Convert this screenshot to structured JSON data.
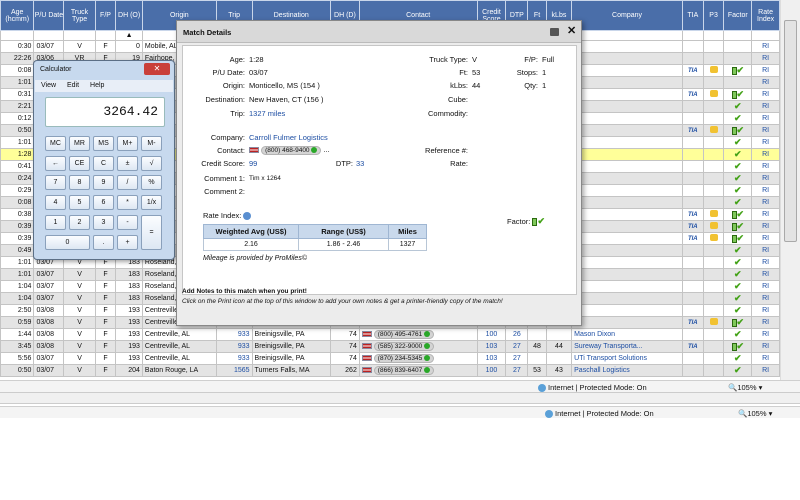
{
  "grid": {
    "headers": [
      "Age (hcmm)",
      "P/U Date",
      "Truck Type",
      "F/P",
      "DH (O)",
      "Origin",
      "Trip",
      "Destination",
      "DH (D)",
      "Contact",
      "Credit Score",
      "DTP",
      "Ft",
      "kLbs",
      "Company",
      "TIA",
      "P3",
      "Factor",
      "Rate Index"
    ],
    "sort_arrow": "▲",
    "rows": [
      {
        "age": "0:30",
        "date": "03/07",
        "truck": "V",
        "fp": "F",
        "dh": "0",
        "origin": "Mobile, AL",
        "trip": "",
        "dest": "",
        "dhd": "",
        "phone": "",
        "credit": "",
        "dtp": "",
        "ft": "",
        "klbs": "",
        "company": "",
        "tia": false,
        "p3": false,
        "factor": false,
        "ri": "RI"
      },
      {
        "age": "22:26",
        "date": "03/06",
        "truck": "VR",
        "fp": "F",
        "dh": "19",
        "origin": "Fairhope, AL",
        "trip": "",
        "dest": "",
        "dhd": "",
        "phone": "",
        "credit": "",
        "dtp": "",
        "ft": "",
        "klbs": "",
        "company": "",
        "tia": false,
        "p3": false,
        "factor": false,
        "ri": "RI"
      },
      {
        "age": "0:08",
        "date": "",
        "truck": "",
        "fp": "",
        "dh": "",
        "origin": "",
        "trip": "",
        "dest": "",
        "dhd": "",
        "phone": "",
        "credit": "",
        "dtp": "",
        "ft": "",
        "klbs": "",
        "company": "",
        "tia": true,
        "p3": true,
        "factor": true,
        "ri": "RI"
      },
      {
        "age": "1:01",
        "date": "",
        "truck": "",
        "fp": "",
        "dh": "",
        "origin": "",
        "trip": "",
        "dest": "",
        "dhd": "",
        "phone": "",
        "credit": "",
        "dtp": "",
        "ft": "",
        "klbs": "",
        "company": "",
        "tia": false,
        "p3": false,
        "factor": false,
        "ri": "RI"
      },
      {
        "age": "0:31",
        "date": "",
        "truck": "",
        "fp": "",
        "dh": "",
        "origin": "",
        "trip": "",
        "dest": "",
        "dhd": "",
        "phone": "",
        "credit": "",
        "dtp": "",
        "ft": "",
        "klbs": "",
        "company": "",
        "tia": true,
        "p3": true,
        "factor": true,
        "ri": "RI"
      },
      {
        "age": "2:21",
        "date": "",
        "truck": "",
        "fp": "",
        "dh": "",
        "origin": "",
        "trip": "",
        "dest": "",
        "dhd": "",
        "phone": "",
        "credit": "",
        "dtp": "",
        "ft": "",
        "klbs": "",
        "company": "",
        "tia": false,
        "p3": false,
        "factor": true,
        "ri": "RI"
      },
      {
        "age": "0:12",
        "date": "",
        "truck": "",
        "fp": "",
        "dh": "",
        "origin": "",
        "trip": "",
        "dest": "",
        "dhd": "",
        "phone": "",
        "credit": "",
        "dtp": "",
        "ft": "",
        "klbs": "",
        "company": "",
        "tia": false,
        "p3": false,
        "factor": true,
        "ri": "RI"
      },
      {
        "age": "0:50",
        "date": "",
        "truck": "",
        "fp": "",
        "dh": "",
        "origin": "",
        "trip": "",
        "dest": "",
        "dhd": "",
        "phone": "",
        "credit": "",
        "dtp": "",
        "ft": "",
        "klbs": "",
        "company": "",
        "tia": true,
        "p3": true,
        "factor": true,
        "ri": "RI"
      },
      {
        "age": "1:01",
        "date": "",
        "truck": "",
        "fp": "",
        "dh": "",
        "origin": "",
        "trip": "",
        "dest": "",
        "dhd": "",
        "phone": "",
        "credit": "",
        "dtp": "",
        "ft": "",
        "klbs": "",
        "company": "",
        "tia": false,
        "p3": false,
        "factor": true,
        "ri": "RI"
      },
      {
        "age": "1:28",
        "date": "",
        "truck": "",
        "fp": "",
        "dh": "",
        "origin": "",
        "trip": "",
        "dest": "",
        "dhd": "",
        "phone": "",
        "credit": "",
        "dtp": "",
        "ft": "",
        "klbs": "",
        "company": "",
        "tia": false,
        "p3": false,
        "factor": true,
        "ri": "RI",
        "hl": true
      },
      {
        "age": "0:41",
        "date": "",
        "truck": "",
        "fp": "",
        "dh": "",
        "origin": "",
        "trip": "",
        "dest": "",
        "dhd": "",
        "phone": "",
        "credit": "",
        "dtp": "",
        "ft": "",
        "klbs": "",
        "company": "",
        "tia": false,
        "p3": false,
        "factor": true,
        "ri": "RI"
      },
      {
        "age": "0:24",
        "date": "",
        "truck": "",
        "fp": "",
        "dh": "",
        "origin": "",
        "trip": "",
        "dest": "",
        "dhd": "",
        "phone": "",
        "credit": "",
        "dtp": "",
        "ft": "",
        "klbs": "",
        "company": "",
        "tia": false,
        "p3": false,
        "factor": true,
        "ri": "RI"
      },
      {
        "age": "0:29",
        "date": "",
        "truck": "",
        "fp": "",
        "dh": "",
        "origin": "",
        "trip": "",
        "dest": "",
        "dhd": "",
        "phone": "",
        "credit": "",
        "dtp": "",
        "ft": "",
        "klbs": "",
        "company": "",
        "tia": false,
        "p3": false,
        "factor": true,
        "ri": "RI"
      },
      {
        "age": "0:08",
        "date": "",
        "truck": "",
        "fp": "",
        "dh": "",
        "origin": "",
        "trip": "",
        "dest": "",
        "dhd": "",
        "phone": "",
        "credit": "",
        "dtp": "",
        "ft": "",
        "klbs": "",
        "company": "",
        "tia": false,
        "p3": false,
        "factor": true,
        "ri": "RI"
      },
      {
        "age": "0:38",
        "date": "",
        "truck": "",
        "fp": "",
        "dh": "",
        "origin": "",
        "trip": "",
        "dest": "",
        "dhd": "",
        "phone": "",
        "credit": "",
        "dtp": "",
        "ft": "",
        "klbs": "",
        "company": "",
        "tia": true,
        "p3": true,
        "factor": true,
        "ri": "RI"
      },
      {
        "age": "0:39",
        "date": "",
        "truck": "",
        "fp": "",
        "dh": "",
        "origin": "",
        "trip": "",
        "dest": "",
        "dhd": "",
        "phone": "",
        "credit": "",
        "dtp": "",
        "ft": "",
        "klbs": "",
        "company": "",
        "tia": true,
        "p3": true,
        "factor": true,
        "ri": "RI"
      },
      {
        "age": "0:39",
        "date": "",
        "truck": "",
        "fp": "",
        "dh": "",
        "origin": "",
        "trip": "",
        "dest": "",
        "dhd": "",
        "phone": "",
        "credit": "",
        "dtp": "",
        "ft": "",
        "klbs": "",
        "company": "",
        "tia": true,
        "p3": true,
        "factor": true,
        "ri": "RI"
      },
      {
        "age": "0:49",
        "date": "",
        "truck": "",
        "fp": "",
        "dh": "",
        "origin": "",
        "trip": "",
        "dest": "",
        "dhd": "",
        "phone": "",
        "credit": "",
        "dtp": "",
        "ft": "",
        "klbs": "",
        "company": "",
        "tia": false,
        "p3": false,
        "factor": true,
        "ri": "RI"
      },
      {
        "age": "1:01",
        "date": "03/07",
        "truck": "V",
        "fp": "F",
        "dh": "183",
        "origin": "Roseland, LA",
        "trip": "",
        "dest": "",
        "dhd": "",
        "phone": "",
        "credit": "",
        "dtp": "",
        "ft": "",
        "klbs": "",
        "company": "",
        "tia": false,
        "p3": false,
        "factor": true,
        "ri": "RI"
      },
      {
        "age": "1:01",
        "date": "03/07",
        "truck": "V",
        "fp": "F",
        "dh": "183",
        "origin": "Roseland, LA",
        "trip": "",
        "dest": "",
        "dhd": "",
        "phone": "",
        "credit": "",
        "dtp": "",
        "ft": "",
        "klbs": "",
        "company": "",
        "tia": false,
        "p3": false,
        "factor": true,
        "ri": "RI"
      },
      {
        "age": "1:04",
        "date": "03/07",
        "truck": "V",
        "fp": "F",
        "dh": "183",
        "origin": "Roseland, LA",
        "trip": "",
        "dest": "",
        "dhd": "",
        "phone": "",
        "credit": "",
        "dtp": "",
        "ft": "",
        "klbs": "",
        "company": "",
        "tia": false,
        "p3": false,
        "factor": true,
        "ri": "RI"
      },
      {
        "age": "1:04",
        "date": "03/07",
        "truck": "V",
        "fp": "F",
        "dh": "183",
        "origin": "Roseland, LA",
        "trip": "",
        "dest": "",
        "dhd": "",
        "phone": "",
        "credit": "",
        "dtp": "",
        "ft": "",
        "klbs": "",
        "company": "",
        "tia": false,
        "p3": false,
        "factor": true,
        "ri": "RI"
      },
      {
        "age": "2:50",
        "date": "03/08",
        "truck": "V",
        "fp": "F",
        "dh": "193",
        "origin": "Centreville, AL",
        "trip": "",
        "dest": "",
        "dhd": "",
        "phone": "",
        "credit": "",
        "dtp": "",
        "ft": "",
        "klbs": "",
        "company": "",
        "tia": false,
        "p3": false,
        "factor": true,
        "ri": "RI"
      },
      {
        "age": "0:59",
        "date": "03/08",
        "truck": "V",
        "fp": "F",
        "dh": "193",
        "origin": "Centreville, AL",
        "trip": "",
        "dest": "",
        "dhd": "",
        "phone": "",
        "credit": "",
        "dtp": "",
        "ft": "",
        "klbs": "",
        "company": "",
        "tia": true,
        "p3": true,
        "factor": true,
        "ri": "RI"
      },
      {
        "age": "1:44",
        "date": "03/08",
        "truck": "V",
        "fp": "F",
        "dh": "193",
        "origin": "Centreville, AL",
        "trip": "933",
        "dest": "Breinigsville, PA",
        "dhd": "74",
        "phone": "(800) 495-4761",
        "credit": "100",
        "dtp": "26",
        "ft": "",
        "klbs": "",
        "company": "Mason Dixon",
        "tia": false,
        "p3": false,
        "factor": true,
        "ri": "RI"
      },
      {
        "age": "3:45",
        "date": "03/08",
        "truck": "V",
        "fp": "F",
        "dh": "193",
        "origin": "Centreville, AL",
        "trip": "933",
        "dest": "Breinigsville, PA",
        "dhd": "74",
        "phone": "(585) 322-9000",
        "credit": "103",
        "dtp": "27",
        "ft": "48",
        "klbs": "44",
        "company": "Sureway Transporta...",
        "tia": true,
        "p3": false,
        "factor": true,
        "ri": "RI"
      },
      {
        "age": "5:56",
        "date": "03/07",
        "truck": "V",
        "fp": "F",
        "dh": "193",
        "origin": "Centreville, AL",
        "trip": "933",
        "dest": "Breinigsville, PA",
        "dhd": "74",
        "phone": "(870) 234-5345",
        "credit": "103",
        "dtp": "27",
        "ft": "",
        "klbs": "",
        "company": "UTi Transport Solutions",
        "tia": false,
        "p3": false,
        "factor": true,
        "ri": "RI"
      },
      {
        "age": "0:50",
        "date": "03/07",
        "truck": "V",
        "fp": "F",
        "dh": "204",
        "origin": "Baton Rouge, LA",
        "trip": "1565",
        "dest": "Turners Falls, MA",
        "dhd": "262",
        "phone": "(866) 839-6407",
        "credit": "100",
        "dtp": "27",
        "ft": "53",
        "klbs": "43",
        "company": "Paschall Logistics",
        "tia": false,
        "p3": false,
        "factor": true,
        "ri": "RI"
      }
    ]
  },
  "statusbar": {
    "zone": "Internet | Protected Mode: On",
    "zoom": "105%"
  },
  "calculator": {
    "title": "Calculator",
    "close": "✕",
    "menu": [
      "View",
      "Edit",
      "Help"
    ],
    "display": "3264.42",
    "keys": [
      [
        "MC",
        "MR",
        "MS",
        "M+",
        "M-"
      ],
      [
        "←",
        "CE",
        "C",
        "±",
        "√"
      ],
      [
        "7",
        "8",
        "9",
        "/",
        "%"
      ],
      [
        "4",
        "5",
        "6",
        "*",
        "1/x"
      ],
      [
        "1",
        "2",
        "3",
        "-",
        "="
      ],
      [
        "0",
        ".",
        "+"
      ]
    ]
  },
  "match": {
    "title": "Match Details",
    "close": "✕",
    "age_l": "Age:",
    "age": "1:28",
    "pu_l": "P/U Date:",
    "pu": "03/07",
    "origin_l": "Origin:",
    "origin": "Monticello, MS (154 )",
    "dest_l": "Destination:",
    "dest": "New Haven, CT (156 )",
    "trip_l": "Trip:",
    "trip": "1327 miles",
    "tt_l": "Truck Type:",
    "tt": "V",
    "ft_l": "Ft:",
    "ft": "53",
    "kl_l": "kLbs:",
    "kl": "44",
    "cube_l": "Cube:",
    "comm_l": "Commodity:",
    "fp_l": "F/P:",
    "fp": "Full",
    "stops_l": "Stops:",
    "stops": "1",
    "qty_l": "Qty:",
    "qty": "1",
    "company_l": "Company:",
    "company": "Carroll Fulmer Logistics",
    "contact_l": "Contact:",
    "phone": "(800) 468-9400",
    "ellipsis": "...",
    "credit_l": "Credit Score:",
    "credit": "99",
    "dtp_l": "DTP:",
    "dtp": "33",
    "ref_l": "Reference #:",
    "rate_l": "Rate:",
    "c1_l": "Comment 1:",
    "c1": "Tim x 1264",
    "c2_l": "Comment 2:",
    "ri_title": "Rate Index:",
    "ri_h": [
      "Weighted Avg (US$)",
      "Range (US$)",
      "Miles"
    ],
    "ri_v": [
      "2.16",
      "1.86 - 2.46",
      "1327"
    ],
    "ri_note": "Mileage is provided by ProMiles©",
    "factor_l": "Factor:",
    "foot1": "Add Notes to this match when you print!",
    "foot2": "Click on the Print icon at the top of this window to add your own notes & get a printer-friendly copy of the match!"
  }
}
